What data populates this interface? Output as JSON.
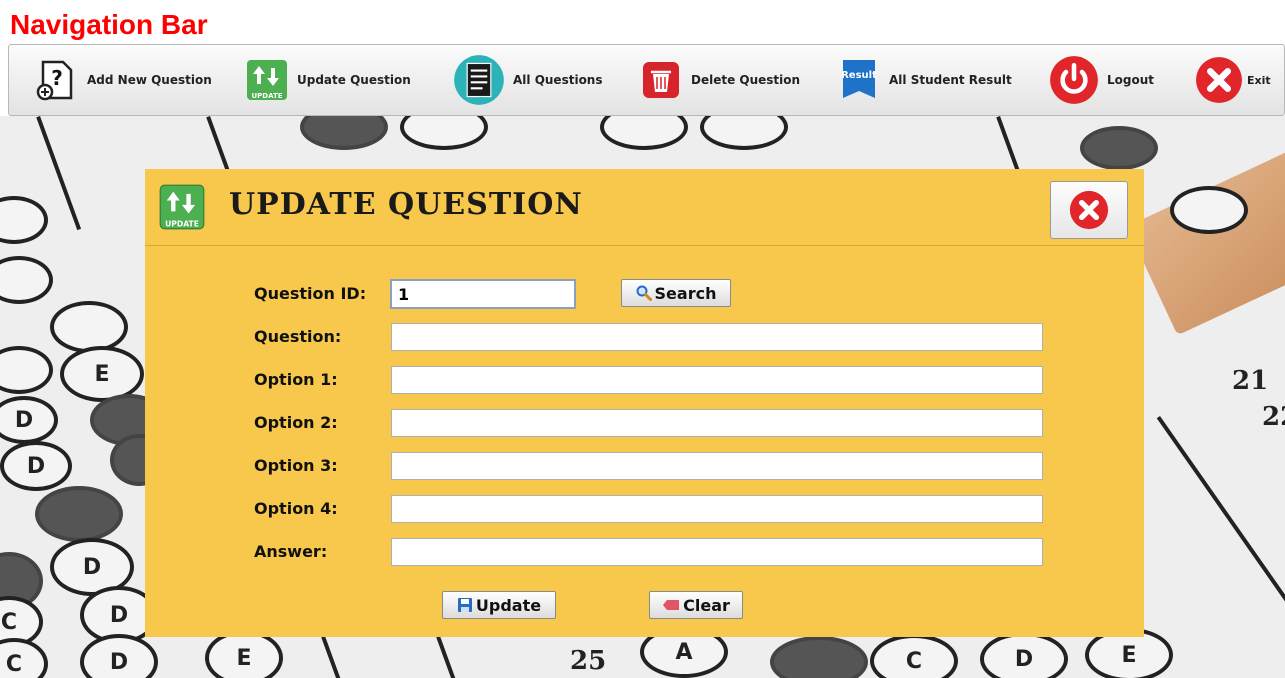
{
  "header": {
    "title": "Navigation Bar"
  },
  "navbar": {
    "items": [
      {
        "label": "Add New Question",
        "icon": "question-doc-icon"
      },
      {
        "label": "Update Question",
        "icon": "update-icon"
      },
      {
        "label": "All Questions",
        "icon": "document-list-icon"
      },
      {
        "label": "Delete Question",
        "icon": "trash-icon"
      },
      {
        "label": "All Student Result",
        "icon": "result-ribbon-icon"
      },
      {
        "label": "Logout",
        "icon": "power-icon"
      },
      {
        "label": "Exit",
        "icon": "close-icon"
      }
    ],
    "result_badge": "Result",
    "update_badge": "UPDATE"
  },
  "dialog": {
    "title": "UPDATE QUESTION",
    "icon_badge": "UPDATE",
    "fields": {
      "question_id": {
        "label": "Question ID:",
        "value": "1"
      },
      "question": {
        "label": "Question:",
        "value": ""
      },
      "option1": {
        "label": "Option 1:",
        "value": ""
      },
      "option2": {
        "label": "Option 2:",
        "value": ""
      },
      "option3": {
        "label": "Option 3:",
        "value": ""
      },
      "option4": {
        "label": "Option 4:",
        "value": ""
      },
      "answer": {
        "label": "Answer:",
        "value": ""
      }
    },
    "buttons": {
      "search": "Search",
      "update": "Update",
      "clear": "Clear"
    }
  },
  "background": {
    "bubble_letters": [
      "D",
      "D",
      "D",
      "D",
      "E",
      "E",
      "A",
      "C",
      "D",
      "E",
      "C",
      "D",
      "C",
      "D",
      "E"
    ],
    "numbers": [
      "25",
      "21",
      "22"
    ]
  },
  "colors": {
    "title_red": "#ff0000",
    "dialog_bg": "#f7c84b",
    "accent_green": "#4caf50",
    "danger_red": "#e0252b"
  }
}
